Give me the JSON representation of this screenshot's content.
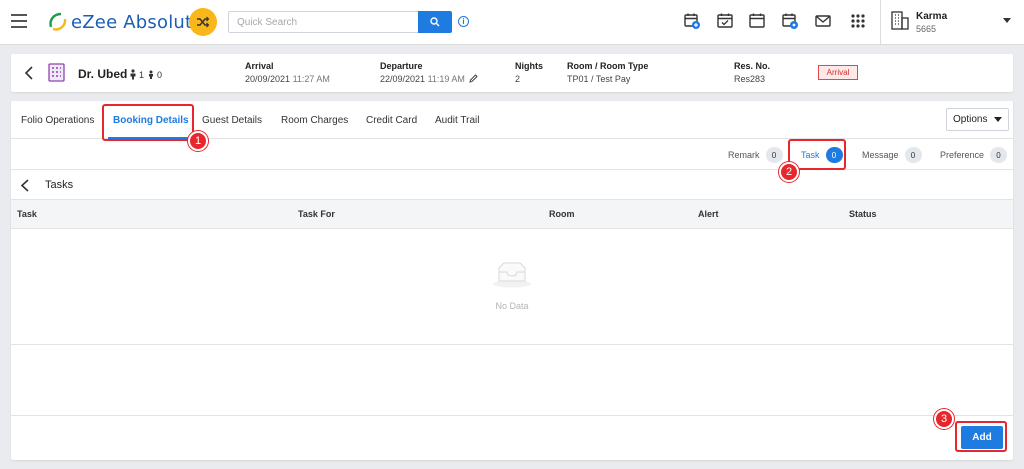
{
  "header": {
    "app_name": "eZee Absolute",
    "search_placeholder": "Quick Search",
    "property": {
      "name": "Karma",
      "code": "5665"
    },
    "icons": [
      "calendar-plus-icon",
      "calendar-check-icon",
      "calendar-icon",
      "calendar-settings-icon",
      "mail-icon",
      "apps-grid-icon"
    ]
  },
  "guest": {
    "name": "Dr. Ubed",
    "adults": "1",
    "children": "0",
    "arrival_label": "Arrival",
    "arrival_date": "20/09/2021",
    "arrival_time": "11:27 AM",
    "departure_label": "Departure",
    "departure_date": "22/09/2021",
    "departure_time": "11:19 AM",
    "nights_label": "Nights",
    "nights": "2",
    "room_label": "Room / Room Type",
    "room": "TP01 / Test Pay",
    "resno_label": "Res. No.",
    "resno": "Res283",
    "status": "Arrival"
  },
  "tabs": {
    "folio": "Folio Operations",
    "booking": "Booking Details",
    "guest": "Guest Details",
    "charges": "Room Charges",
    "card": "Credit Card",
    "audit": "Audit Trail",
    "options": "Options"
  },
  "subtabs": {
    "remark": "Remark",
    "remark_count": "0",
    "task": "Task",
    "task_count": "0",
    "message": "Message",
    "message_count": "0",
    "preference": "Preference",
    "preference_count": "0"
  },
  "tasks": {
    "title": "Tasks",
    "columns": [
      "Task",
      "Task For",
      "Room",
      "Alert",
      "Status"
    ],
    "empty_text": "No Data",
    "add_label": "Add"
  },
  "annotations": [
    "1",
    "2",
    "3"
  ],
  "colors": {
    "accent": "#1e7be0",
    "annotation": "#e8262d",
    "logo_badge": "#f9b71a"
  }
}
